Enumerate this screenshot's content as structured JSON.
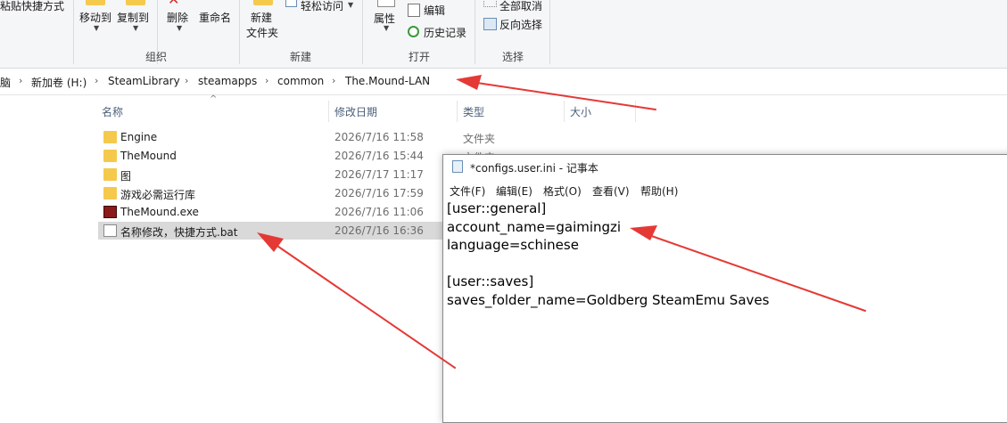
{
  "ribbon": {
    "paste_shortcut_label": "粘贴快捷方式",
    "move_to_label": "移动到",
    "copy_to_label": "复制到",
    "delete_label": "删除",
    "rename_label": "重命名",
    "group_organize": "组织",
    "new_folder_label_1": "新建",
    "new_folder_label_2": "文件夹",
    "easy_access_label": "轻松访问",
    "group_new": "新建",
    "properties_label": "属性",
    "edit_label": "编辑",
    "history_label": "历史记录",
    "group_open": "打开",
    "select_none_label": "全部取消",
    "invert_selection_label": "反向选择",
    "group_select": "选择"
  },
  "address_bar": {
    "crumbs": [
      "脑",
      "新加卷 (H:)",
      "SteamLibrary",
      "steamapps",
      "common",
      "The.Mound-LAN"
    ]
  },
  "file_list": {
    "columns": {
      "name": "名称",
      "date": "修改日期",
      "type": "类型",
      "size": "大小"
    },
    "rows": [
      {
        "name": "Engine",
        "date": "2026/7/16 11:58",
        "type": "文件夹",
        "icon": "folder-icon"
      },
      {
        "name": "TheMound",
        "date": "2026/7/16 15:44",
        "type": "文件夹",
        "icon": "folder-icon"
      },
      {
        "name": "图",
        "date": "2026/7/17 11:17",
        "type": "",
        "icon": "folder-icon"
      },
      {
        "name": "游戏必需运行库",
        "date": "2026/7/16 17:59",
        "type": "",
        "icon": "folder-icon"
      },
      {
        "name": "TheMound.exe",
        "date": "2026/7/16 11:06",
        "type": "",
        "icon": "exe-icon"
      },
      {
        "name": "名称修改，快捷方式.bat",
        "date": "2026/7/16 16:36",
        "type": "",
        "icon": "bat-icon",
        "selected": true
      }
    ]
  },
  "notepad": {
    "title": "*configs.user.ini - 记事本",
    "menu": [
      "文件(F)",
      "编辑(E)",
      "格式(O)",
      "查看(V)",
      "帮助(H)"
    ],
    "lines": [
      "[user::general]",
      "account_name=gaimingzi",
      "language=schinese",
      "",
      "[user::saves]",
      "saves_folder_name=Goldberg SteamEmu Saves"
    ]
  },
  "colors": {
    "annotation_arrow": "#e53935",
    "folder": "#f5c94c",
    "selection": "#d9d9d9"
  }
}
